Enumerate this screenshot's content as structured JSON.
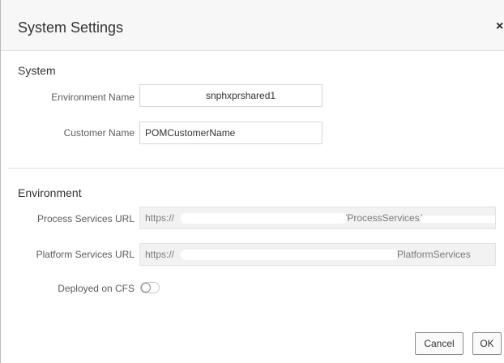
{
  "dialog": {
    "title": "System Settings",
    "close_glyph": "×"
  },
  "system": {
    "section_title": "System",
    "environment_name": {
      "label": "Environment Name",
      "value": "snphxprshared1"
    },
    "customer_name": {
      "label": "Customer Name",
      "value": "POMCustomerName"
    }
  },
  "environment": {
    "section_title": "Environment",
    "process_services": {
      "label": "Process Services URL",
      "value_start": "https://",
      "value_mid": "/ProcessServices/"
    },
    "platform_services": {
      "label": "Platform Services URL",
      "value_start": "https://",
      "value_end": "PlatformServices"
    },
    "deployed_on_cfs": {
      "label": "Deployed on CFS",
      "state": "off"
    }
  },
  "buttons": {
    "cancel": "Cancel",
    "ok": "OK"
  }
}
